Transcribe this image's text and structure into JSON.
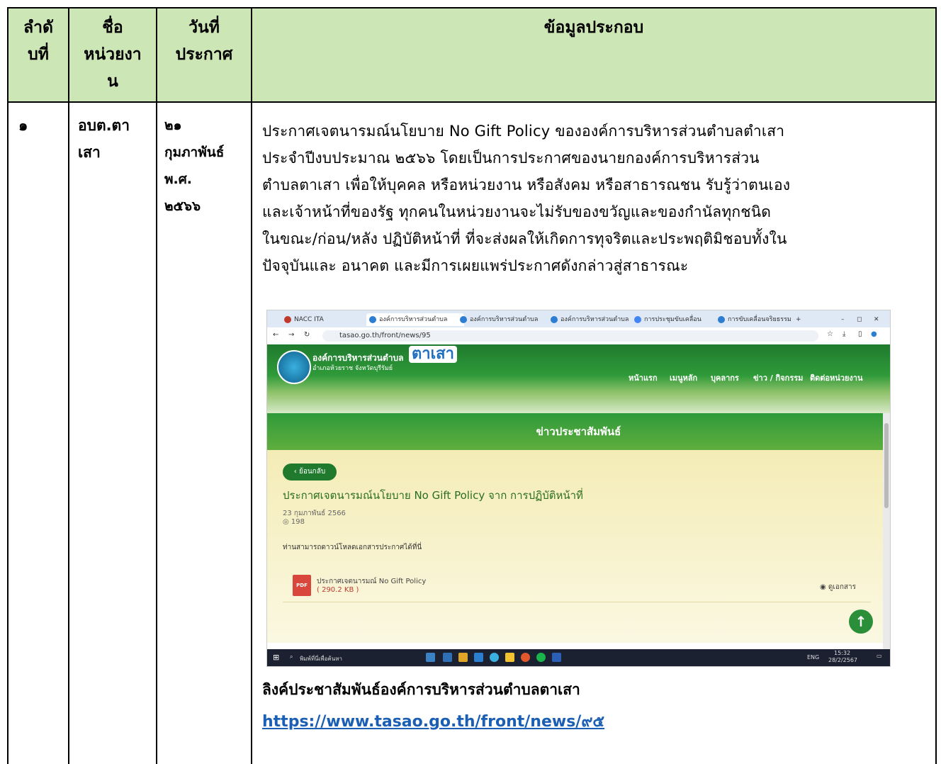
{
  "table": {
    "headers": {
      "col1": [
        "ลำดั",
        "บที่"
      ],
      "col2": [
        "ชื่อ",
        "หน่วยงา",
        "น"
      ],
      "col3": [
        "วันที่",
        "ประกาศ"
      ],
      "col4": "ข้อมูลประกอบ"
    },
    "row": {
      "order": "๑",
      "agency": [
        "อบต.ตา",
        "เสา"
      ],
      "date": [
        "๒๑",
        "กุมภาพันธ์",
        "พ.ศ.",
        "๒๕๖๖"
      ],
      "description": [
        "ประกาศเจตนารมณ์นโยบาย No Gift Policy ขององค์การบริหารส่วนตำบลตำเสา",
        "ประจำปีงบประมาณ ๒๕๖๖ โดยเป็นการประกาศของนายกองค์การบริหารส่วน",
        "ตำบลตาเสา เพื่อให้บุคคล หรือหน่วยงาน หรือสังคม หรือสาธารณชน รับรู้ว่าตนเอง",
        "และเจ้าหน้าที่ของรัฐ ทุกคนในหน่วยงานจะไม่รับของขวัญและของกำนัลทุกชนิด",
        "ในขณะ/ก่อน/หลัง ปฏิบัติหน้าที่ ที่จะส่งผลให้เกิดการทุจริตและประพฤติมิชอบทั้งใน",
        "ปัจจุบันและ อนาคต และมีการเผยแพร่ประกาศดังกล่าวสู่สาธารณะ"
      ],
      "caption": "ลิงค์ประชาสัมพันธ์องค์การบริหารส่วนตำบลตาเสา",
      "link": "https://www.tasao.go.th/front/news/๙๕"
    }
  },
  "screenshot": {
    "tabs": [
      "NACC ITA",
      "องค์การบริหารส่วนตำบล",
      "องค์การบริหารส่วนตำบล",
      "องค์การบริหารส่วนตำบล",
      "การประชุมขับเคลื่อน",
      "การขับเคลื่อนจริยธรรม"
    ],
    "address": "tasao.go.th/front/news/95",
    "site_name": "องค์การบริหารส่วนตำบล",
    "site_name_big": "ตาเสา",
    "site_sub": "อำเภอห้วยราช จังหวัดบุรีรัมย์",
    "menu": [
      "หน้าแรก",
      "เมนูหลัก",
      "บุคลากร",
      "ข่าว / กิจกรรม",
      "ติดต่อหน่วยงาน"
    ],
    "section_title": "ข่าวประชาสัมพันธ์",
    "back_label": "‹ ย้อนกลับ",
    "news_title": "ประกาศเจตนารมณ์นโยบาย No Gift Policy จาก การปฏิบัติหน้าที่",
    "news_date": "23 กุมภาพันธ์ 2566",
    "views": "◎ 198",
    "download_hint": "ท่านสามารถดาวน์โหลดเอกสารประกาศได้ที่นี่",
    "file_name": "ประกาศเจตนารมณ์ No Gift Policy",
    "file_size": "( 290.2 KB )",
    "view_doc": "◉ ดูเอกสาร",
    "pdf_label": "PDF",
    "taskbar_search": "พิมพ์ที่นี่เพื่อค้นหา",
    "taskbar_lang": "ENG",
    "taskbar_time": "15:32",
    "taskbar_date": "28/2/2567",
    "accent": "#cde6b5"
  }
}
